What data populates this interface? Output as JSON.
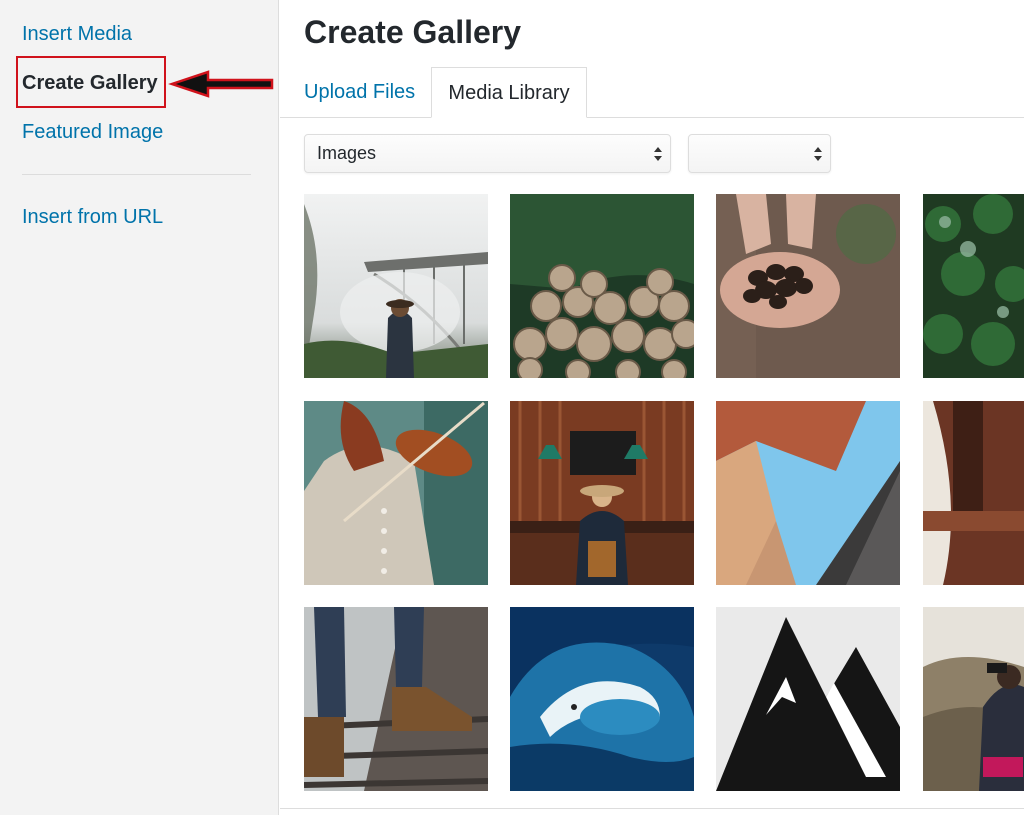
{
  "sidebar": {
    "items": [
      {
        "label": "Insert Media"
      },
      {
        "label": "Create Gallery"
      },
      {
        "label": "Featured Image"
      },
      {
        "label": "Insert from URL"
      }
    ]
  },
  "main": {
    "title": "Create Gallery",
    "tabs": [
      {
        "label": "Upload Files"
      },
      {
        "label": "Media Library"
      }
    ],
    "filters": {
      "type_selected": "Images",
      "date_selected": ""
    }
  },
  "thumbnails": [
    {
      "icon": "foggy-bridge-hiker-image"
    },
    {
      "icon": "log-pile-image"
    },
    {
      "icon": "hands-pinecones-image"
    },
    {
      "icon": "forest-aerial-image"
    },
    {
      "icon": "violinist-image"
    },
    {
      "icon": "cafe-counter-image"
    },
    {
      "icon": "buildings-looking-up-image"
    },
    {
      "icon": "wooden-tower-image"
    },
    {
      "icon": "boots-on-railway-image"
    },
    {
      "icon": "ocean-wave-surfer-image"
    },
    {
      "icon": "mountain-logo-image"
    },
    {
      "icon": "binoculars-hiker-image"
    }
  ],
  "colors": {
    "link": "#0073aa",
    "highlight": "#d0121b",
    "sidebar_bg": "#f3f3f3"
  }
}
